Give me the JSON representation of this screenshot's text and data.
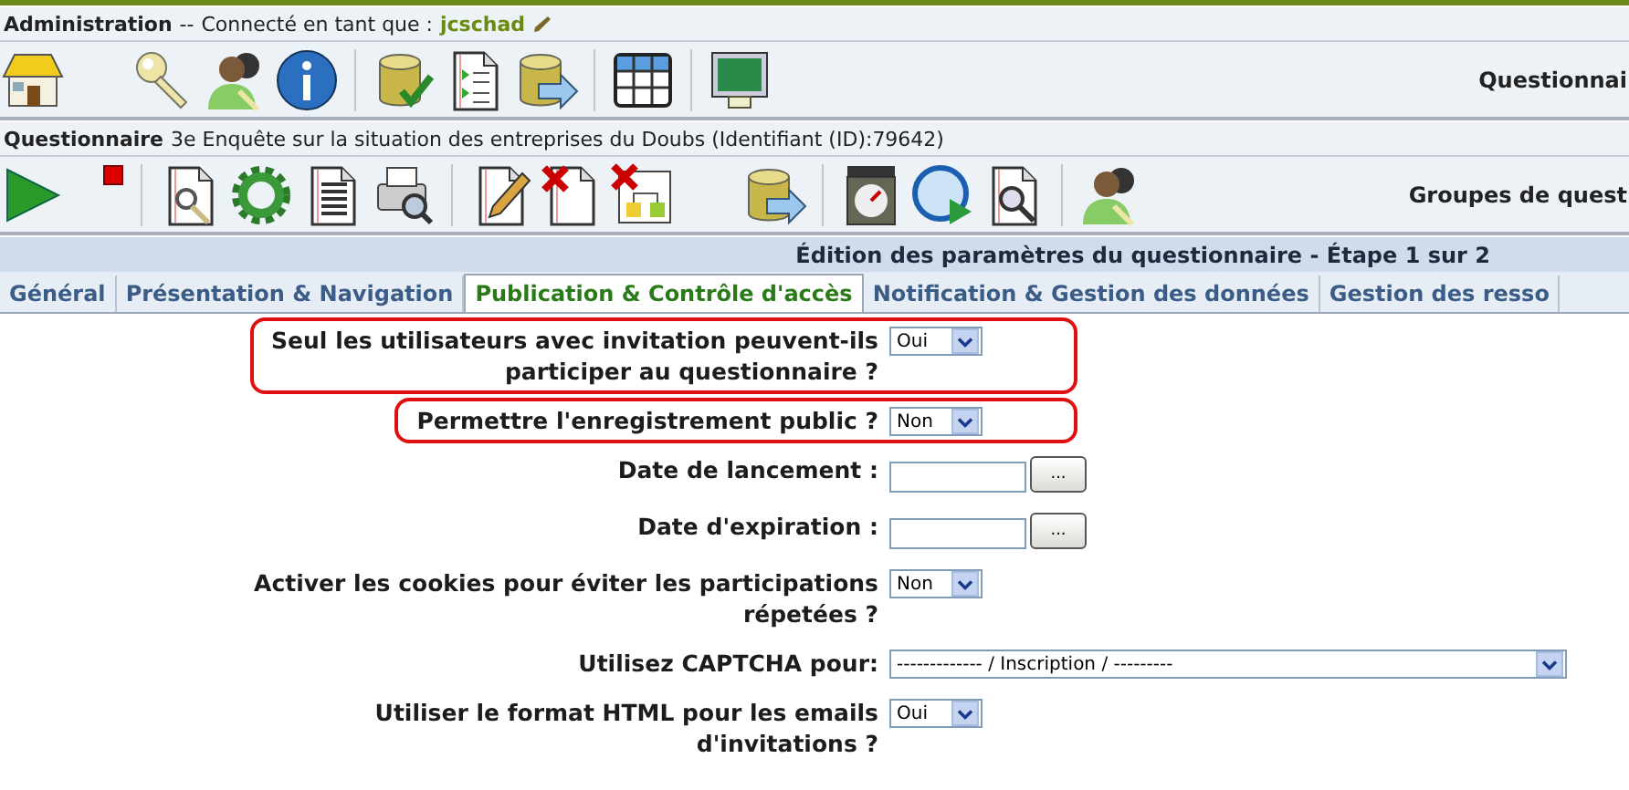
{
  "admin_bar": {
    "title": "Administration",
    "separator": "--",
    "status": "Connecté en tant que :",
    "user": "jcschad"
  },
  "admin_toolbar": {
    "label": "Questionnai"
  },
  "survey_bar": {
    "title": "Questionnaire",
    "name": "3e Enquête sur la situation des entreprises du Doubs (Identifiant (ID):79642)"
  },
  "survey_toolbar": {
    "label": "Groupes de quest"
  },
  "header": {
    "title": "Édition des paramètres du questionnaire - Étape 1 sur 2"
  },
  "tabs": [
    {
      "label": "Général",
      "selected": false
    },
    {
      "label": "Présentation & Navigation",
      "selected": false
    },
    {
      "label": "Publication & Contrôle d'accès",
      "selected": true
    },
    {
      "label": "Notification & Gestion des données",
      "selected": false
    },
    {
      "label": "Gestion des resso",
      "selected": false
    }
  ],
  "fields": [
    {
      "kind": "select",
      "label": [
        "Seul les utilisateurs avec invitation peuvent-ils",
        "participer au questionnaire ?"
      ],
      "value": "Oui",
      "highlighted": true
    },
    {
      "kind": "select",
      "label": [
        "Permettre l'enregistrement public ?"
      ],
      "value": "Non",
      "highlighted": true
    },
    {
      "kind": "date",
      "label": [
        "Date de lancement :"
      ],
      "button": "...",
      "highlighted": false
    },
    {
      "kind": "date",
      "label": [
        "Date d'expiration :"
      ],
      "button": "...",
      "highlighted": false
    },
    {
      "kind": "select",
      "label": [
        "Activer les cookies pour éviter les participations",
        "répetées ?"
      ],
      "value": "Non",
      "highlighted": false
    },
    {
      "kind": "wide-select",
      "label": [
        "Utilisez CAPTCHA pour:"
      ],
      "value": "------------- / Inscription / ---------",
      "highlighted": false
    },
    {
      "kind": "select",
      "label": [
        "Utiliser le format HTML pour les emails",
        "d'invitations ?"
      ],
      "value": "Oui",
      "highlighted": false
    }
  ]
}
